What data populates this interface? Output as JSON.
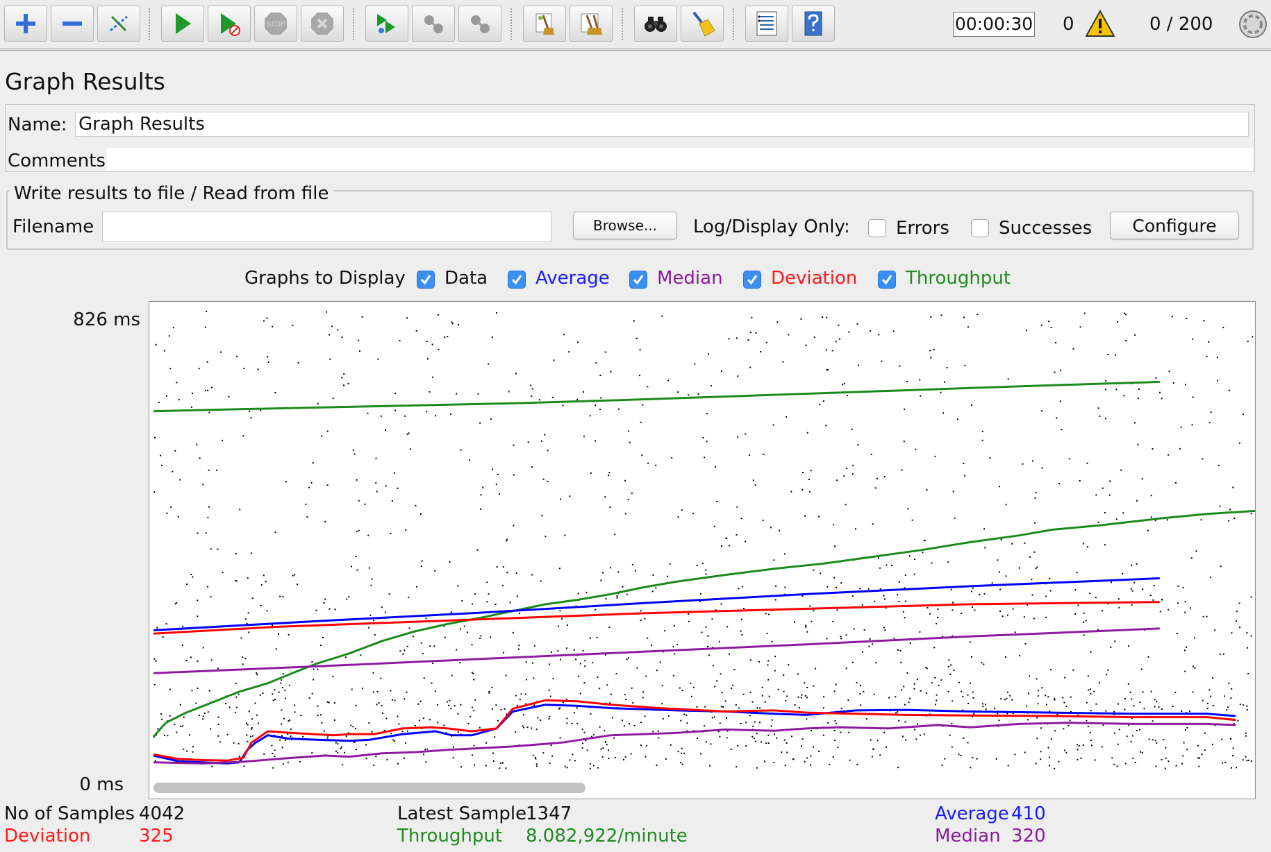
{
  "toolbar": {
    "buttons": [
      {
        "name": "add-button",
        "icon": "plus-icon"
      },
      {
        "name": "remove-button",
        "icon": "minus-icon"
      },
      {
        "name": "toggle-button",
        "icon": "toggle-icon"
      },
      {
        "name": "start-button",
        "icon": "play-icon"
      },
      {
        "name": "start-no-pauses-button",
        "icon": "play-no-pause-icon"
      },
      {
        "name": "stop-button",
        "icon": "stop-icon"
      },
      {
        "name": "shutdown-button",
        "icon": "shutdown-icon"
      },
      {
        "name": "remote-start-button",
        "icon": "remote-start-icon"
      },
      {
        "name": "remote-stop-button",
        "icon": "remote-stop-icon"
      },
      {
        "name": "remote-shutdown-button",
        "icon": "remote-shutdown-icon"
      },
      {
        "name": "clear-button",
        "icon": "broom-icon"
      },
      {
        "name": "clear-all-button",
        "icon": "broom-all-icon"
      },
      {
        "name": "search-button",
        "icon": "binoculars-icon"
      },
      {
        "name": "reset-search-button",
        "icon": "broom-yellow-icon"
      },
      {
        "name": "function-helper-button",
        "icon": "list-icon"
      },
      {
        "name": "help-button",
        "icon": "help-icon"
      }
    ],
    "stop_label": "STOP",
    "timer": "00:00:30",
    "warnings": "0",
    "threads": "0 / 200"
  },
  "page": {
    "title": "Graph Results",
    "name_label": "Name:",
    "name_value": "Graph Results",
    "comments_label": "Comments:",
    "comments_value": ""
  },
  "file": {
    "legend": "Write results to file / Read from file",
    "filename_label": "Filename",
    "filename_value": "",
    "browse_label": "Browse...",
    "log_display_label": "Log/Display Only:",
    "errors_label": "Errors",
    "errors_checked": false,
    "successes_label": "Successes",
    "successes_checked": false,
    "configure_label": "Configure"
  },
  "graphs_to_display": {
    "label": "Graphs to Display",
    "options": [
      {
        "label": "Data",
        "checked": true,
        "color": "#111111"
      },
      {
        "label": "Average",
        "checked": true,
        "color": "#1a1aff"
      },
      {
        "label": "Median",
        "checked": true,
        "color": "#8b1a9c"
      },
      {
        "label": "Deviation",
        "checked": true,
        "color": "#ff1a1a"
      },
      {
        "label": "Throughput",
        "checked": true,
        "color": "#218a21"
      }
    ]
  },
  "colors": {
    "data": "#000000",
    "average": "#0000ff",
    "median": "#8e1b9f",
    "deviation": "#ff0000",
    "throughput": "#1a8a1a"
  },
  "chart_data": {
    "type": "line",
    "y_max_label": "826  ms",
    "y_min_label": "0  ms",
    "ylim": [
      0,
      826
    ],
    "series": [
      {
        "key": "throughput",
        "lines": [
          {
            "x": [
              0,
              120,
              280,
              440,
              580,
              720,
              860,
              1000,
              1100,
              1232
            ],
            "y": [
              642,
              646,
              651,
              656,
              662,
              669,
              676,
              683,
              688,
              694
            ]
          },
          {
            "x": [
              0,
              15,
              40,
              70,
              105,
              140,
              170,
              200,
              240,
              280,
              320,
              360,
              400,
              440,
              480,
              520,
              560,
              600,
              640,
              700,
              760,
              820,
              880,
              940,
              1000,
              1060,
              1100,
              1160,
              1232,
              1290,
              1355
            ],
            "y": [
              65,
              90,
              108,
              125,
              145,
              160,
              178,
              195,
              213,
              235,
              252,
              265,
              276,
              288,
              300,
              308,
              318,
              330,
              340,
              352,
              363,
              372,
              384,
              396,
              410,
              422,
              432,
              440,
              452,
              460,
              466
            ]
          }
        ]
      },
      {
        "key": "average",
        "lines": [
          {
            "x": [
              0,
              200,
              400,
              600,
              800,
              1000,
              1232
            ],
            "y": [
              254,
              270,
              285,
              302,
              318,
              332,
              346
            ]
          },
          {
            "x": [
              0,
              30,
              60,
              90,
              105,
              115,
              125,
              140,
              165,
              200,
              240,
              265,
              305,
              345,
              365,
              390,
              420,
              440,
              480,
              520,
              560,
              600,
              640,
              700,
              760,
              800,
              860,
              920,
              1000,
              1100,
              1200,
              1290,
              1325
            ],
            "y": [
              32,
              22,
              20,
              18,
              20,
              42,
              55,
              68,
              62,
              60,
              58,
              60,
              70,
              75,
              68,
              68,
              80,
              110,
              122,
              120,
              116,
              114,
              112,
              110,
              106,
              104,
              112,
              113,
              110,
              108,
              106,
              106,
              102
            ]
          }
        ]
      },
      {
        "key": "deviation",
        "lines": [
          {
            "x": [
              0,
              150,
              300,
              450,
              600,
              800,
              1000,
              1232
            ],
            "y": [
              248,
              260,
              268,
              276,
              284,
              292,
              300,
              304
            ]
          },
          {
            "x": [
              0,
              30,
              60,
              90,
              110,
              120,
              140,
              170,
              220,
              240,
              270,
              305,
              340,
              360,
              390,
              420,
              440,
              480,
              520,
              560,
              620,
              700,
              760,
              800,
              860,
              920,
              1000,
              1100,
              1200,
              1290,
              1325
            ],
            "y": [
              34,
              26,
              24,
              23,
              28,
              55,
              75,
              72,
              68,
              70,
              70,
              80,
              82,
              80,
              75,
              80,
              115,
              130,
              128,
              122,
              116,
              110,
              112,
              108,
              106,
              104,
              103,
              102,
              100,
              100,
              95
            ]
          }
        ]
      },
      {
        "key": "median",
        "lines": [
          {
            "x": [
              0,
              200,
              400,
              600,
              800,
              1000,
              1232
            ],
            "y": [
              178,
              190,
              203,
              216,
              229,
              243,
              257
            ]
          },
          {
            "x": [
              0,
              60,
              110,
              170,
              210,
              240,
              280,
              320,
              360,
              400,
              440,
              500,
              560,
              600,
              640,
              700,
              760,
              800,
              840,
              900,
              960,
              1000,
              1060,
              1120,
              1200,
              1290,
              1325
            ],
            "y": [
              20,
              18,
              21,
              28,
              32,
              30,
              36,
              38,
              42,
              45,
              48,
              55,
              68,
              70,
              72,
              78,
              76,
              80,
              82,
              80,
              86,
              82,
              88,
              90,
              88,
              88,
              86
            ]
          }
        ]
      }
    ]
  },
  "stats": {
    "samples_label": "No of Samples",
    "samples_value": "4042",
    "deviation_label": "Deviation",
    "deviation_value": "325",
    "latest_label": "Latest Sample",
    "latest_value": "1347",
    "throughput_label": "Throughput",
    "throughput_value": "8.082,922/minute",
    "average_label": "Average",
    "average_value": "410",
    "median_label": "Median",
    "median_value": "320"
  }
}
